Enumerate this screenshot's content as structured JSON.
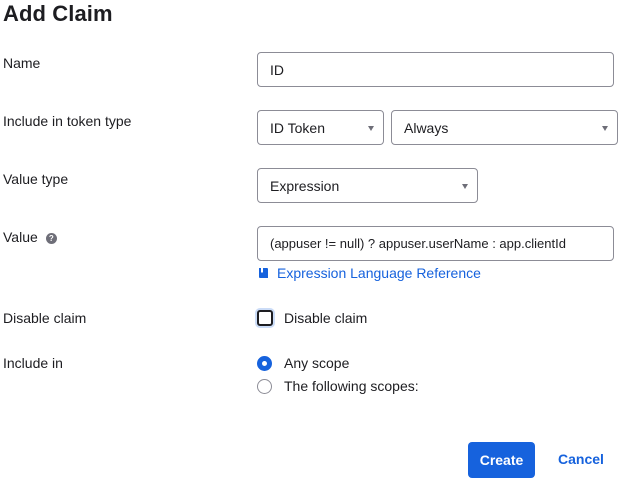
{
  "dialog": {
    "title": "Add Claim"
  },
  "form": {
    "name": {
      "label": "Name",
      "value": "ID"
    },
    "token_type": {
      "label": "Include in token type",
      "type_value": "ID Token",
      "frequency_value": "Always"
    },
    "value_type": {
      "label": "Value type",
      "value": "Expression"
    },
    "value": {
      "label": "Value",
      "help_icon_text": "?",
      "expression": "(appuser != null) ? appuser.userName : app.clientId",
      "reference_link": "Expression Language Reference"
    },
    "disable_claim": {
      "label": "Disable claim",
      "checkbox_label": "Disable claim",
      "checked": false
    },
    "include_in": {
      "label": "Include in",
      "options": [
        {
          "label": "Any scope",
          "selected": true
        },
        {
          "label": "The following scopes:",
          "selected": false
        }
      ]
    }
  },
  "actions": {
    "create_label": "Create",
    "cancel_label": "Cancel"
  },
  "colors": {
    "accent": "#1662dd",
    "text": "#1d1d21",
    "border": "#8c8c96"
  },
  "icons": {
    "help": "question-circle-icon",
    "link": "book-icon",
    "dropdown": "caret-down-icon"
  }
}
